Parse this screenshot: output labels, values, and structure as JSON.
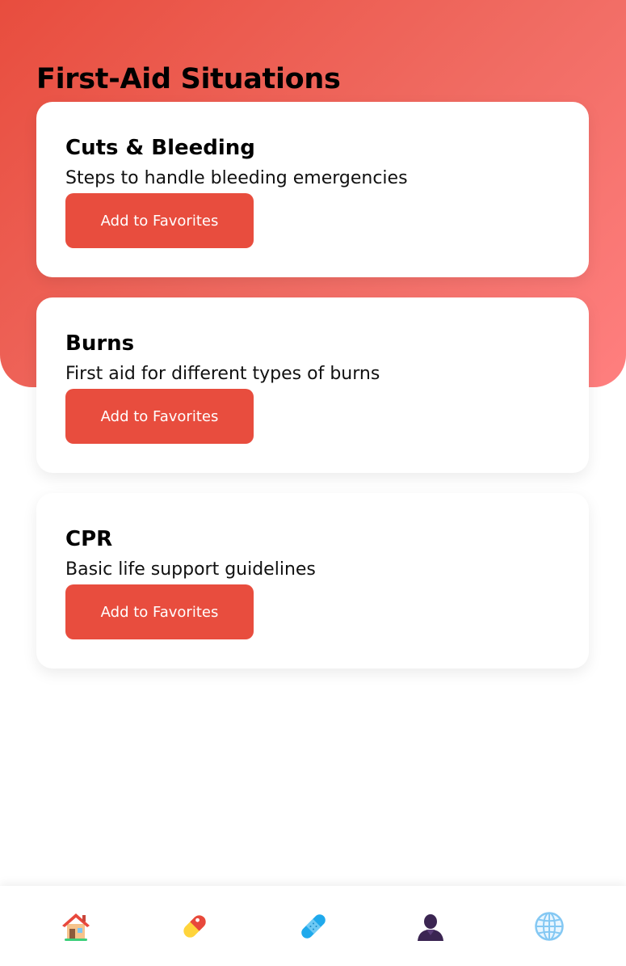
{
  "header": {
    "title": "First-Aid Situations"
  },
  "cards": [
    {
      "title": "Cuts & Bleeding",
      "description": "Steps to handle bleeding emergencies",
      "button_label": "Add to Favorites"
    },
    {
      "title": "Burns",
      "description": "First aid for different types of burns",
      "button_label": "Add to Favorites"
    },
    {
      "title": "CPR",
      "description": "Basic life support guidelines",
      "button_label": "Add to Favorites"
    }
  ],
  "nav": {
    "items": [
      {
        "icon": "home-icon"
      },
      {
        "icon": "pill-icon"
      },
      {
        "icon": "bandage-icon"
      },
      {
        "icon": "person-icon"
      },
      {
        "icon": "globe-icon"
      }
    ]
  },
  "colors": {
    "accent": "#e84d3e",
    "header_gradient_start": "#e84d3e",
    "header_gradient_end": "#ff7f7f"
  }
}
